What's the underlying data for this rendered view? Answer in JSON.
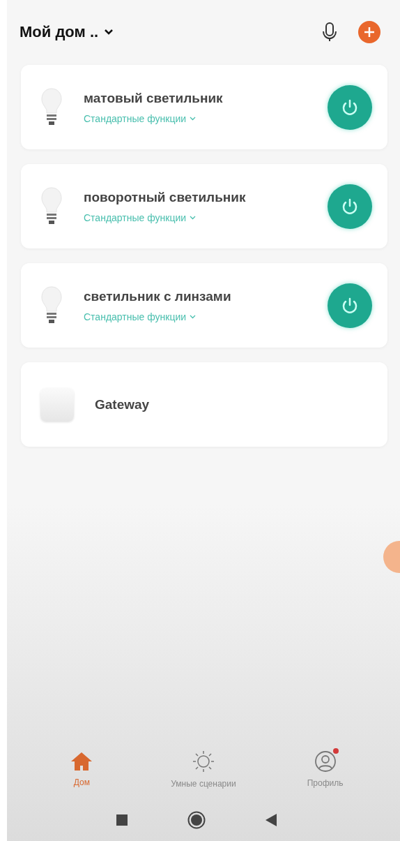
{
  "header": {
    "title": "Мой дом .."
  },
  "devices": [
    {
      "kind": "light",
      "name": "матовый светильник",
      "functions": "Стандартные функции",
      "on": true
    },
    {
      "kind": "light",
      "name": "поворотный светильник",
      "functions": "Стандартные функции",
      "on": true
    },
    {
      "kind": "light",
      "name": "светильник с линзами",
      "functions": "Стандартные функции",
      "on": true
    },
    {
      "kind": "gateway",
      "name": "Gateway"
    }
  ],
  "nav": [
    {
      "kind": "home",
      "label": "Дом",
      "selected": true
    },
    {
      "kind": "scenes",
      "label": "Умные сценарии",
      "selected": false
    },
    {
      "kind": "profile",
      "label": "Профиль",
      "selected": false,
      "badge": true
    }
  ]
}
